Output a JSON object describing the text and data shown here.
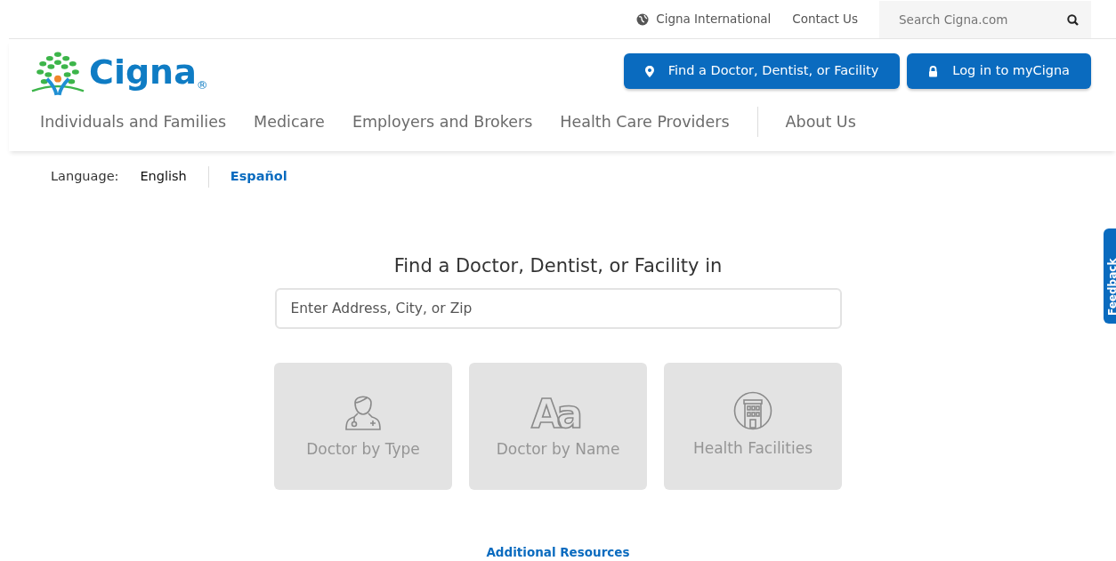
{
  "utility_bar": {
    "links": [
      "Cigna International",
      "Contact Us"
    ],
    "search": {
      "placeholder": "Search Cigna.com"
    }
  },
  "logo": {
    "wordmark": "Cigna",
    "registered": "®"
  },
  "header_buttons": [
    {
      "label": "Find a Doctor, Dentist, or Facility",
      "kind": "pin"
    },
    {
      "label": "Log in to myCigna",
      "kind": "lock"
    }
  ],
  "nav": [
    {
      "label": "Individuals and Families"
    },
    {
      "label": "Medicare"
    },
    {
      "label": "Employers and Brokers"
    },
    {
      "label": "Health Care Providers"
    },
    {
      "label": "About Us"
    }
  ],
  "language": {
    "label": "Language:",
    "options": [
      {
        "label": "English",
        "selected": true
      },
      {
        "label": "Español",
        "selected": false
      }
    ]
  },
  "finder": {
    "heading": "Find a Doctor, Dentist, or Facility in",
    "location": {
      "placeholder": "Enter Address, City, or Zip"
    },
    "options": [
      {
        "label": "Doctor by Type",
        "kind": "doctor"
      },
      {
        "label": "Doctor by Name",
        "kind": "letters",
        "icon_text": "Aa"
      },
      {
        "label": "Health Facilities",
        "kind": "building"
      }
    ],
    "resources_link": "Additional Resources"
  },
  "feedback_tab": {
    "label": "Feedback"
  }
}
